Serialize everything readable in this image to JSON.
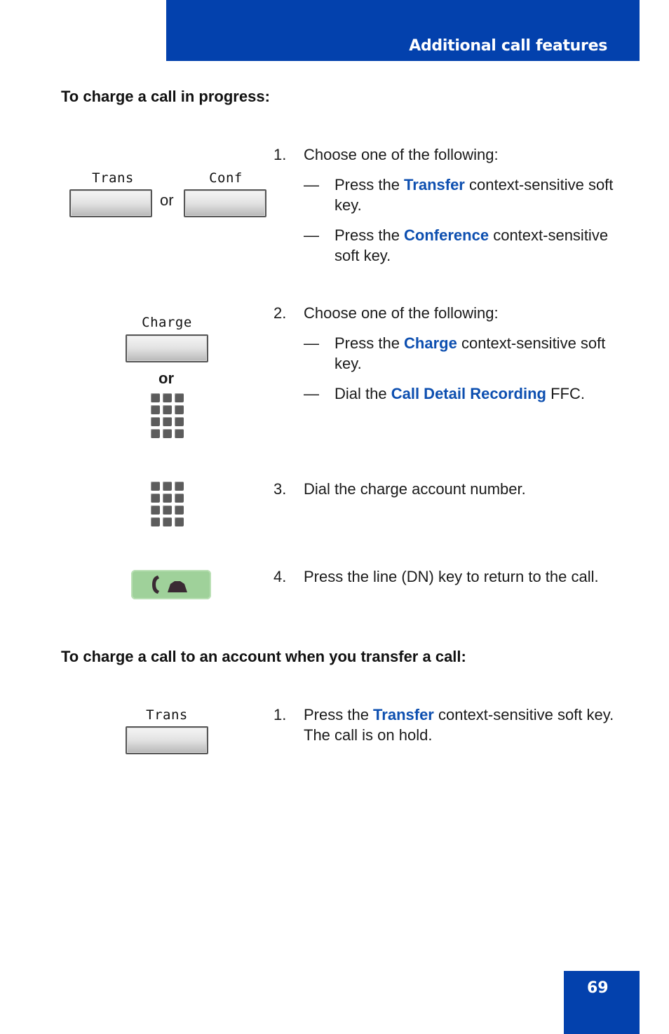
{
  "header": {
    "title": "Additional call features"
  },
  "page_number": "69",
  "sections": [
    {
      "heading": "To charge a call in progress:",
      "steps": [
        {
          "number": "1.",
          "text": "Choose one of the following:",
          "options": [
            {
              "pre": "Press the ",
              "highlight": "Transfer",
              "post": " context-sensitive soft key."
            },
            {
              "pre": "Press the ",
              "highlight": "Conference",
              "post": " context-sensitive soft key."
            }
          ],
          "icons": {
            "softkey_a": "Trans",
            "softkey_b": "Conf",
            "or": "or"
          }
        },
        {
          "number": "2.",
          "text": "Choose one of the following:",
          "options": [
            {
              "pre": "Press the ",
              "highlight": "Charge",
              "post": " context-sensitive soft key."
            },
            {
              "pre": "Dial the ",
              "highlight": "Call Detail Recording",
              "post": " FFC."
            }
          ],
          "icons": {
            "softkey": "Charge",
            "or": "or",
            "keypad": "keypad-icon"
          }
        },
        {
          "number": "3.",
          "text": "Dial the charge account number.",
          "icons": {
            "keypad": "keypad-icon"
          }
        },
        {
          "number": "4.",
          "text": "Press the line (DN) key to return to the call.",
          "icons": {
            "line_key": "line-key-icon"
          }
        }
      ]
    },
    {
      "heading": "To charge a call to an account when you transfer a call:",
      "steps": [
        {
          "number": "1.",
          "pre": "Press the ",
          "highlight": "Transfer",
          "post": " context-sensitive soft key. The call is on hold.",
          "icons": {
            "softkey": "Trans"
          }
        }
      ]
    }
  ],
  "dash": "—",
  "colors": {
    "brand_blue": "#0341ad",
    "highlight_blue": "#0d4fb0",
    "line_key_green": "#9fd19a"
  }
}
